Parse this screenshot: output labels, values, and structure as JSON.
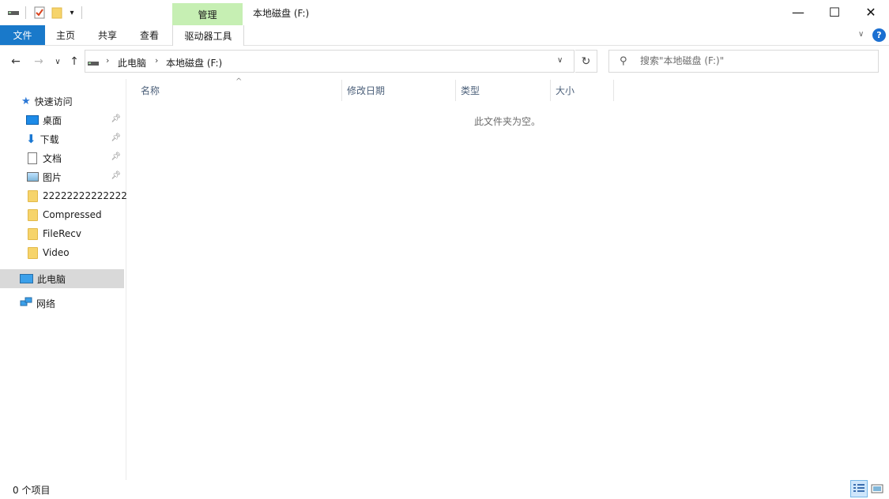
{
  "window": {
    "title": "本地磁盘 (F:)",
    "context_tab_group": "管理",
    "controls": {
      "minimize": "—",
      "maximize": "☐",
      "close": "✕"
    }
  },
  "ribbon": {
    "tabs": [
      "文件",
      "主页",
      "共享",
      "查看",
      "驱动器工具"
    ],
    "help": "?",
    "collapse": "∨"
  },
  "address": {
    "crumbs": [
      "此电脑",
      "本地磁盘 (F:)"
    ],
    "separator": "›",
    "dropdown": "∨",
    "refresh": "↻"
  },
  "search": {
    "placeholder": "搜索\"本地磁盘 (F:)\""
  },
  "nav": {
    "quick_access": "快速访问",
    "pinned": [
      "桌面",
      "下载",
      "文档",
      "图片"
    ],
    "folders": [
      "22222222222222",
      "Compressed",
      "FileRecv",
      "Video"
    ],
    "this_pc": "此电脑",
    "network": "网络"
  },
  "columns": [
    "名称",
    "修改日期",
    "类型",
    "大小"
  ],
  "empty_message": "此文件夹为空。",
  "status": {
    "item_count": "0 个项目"
  },
  "colors": {
    "accent": "#1979ca",
    "manage_tab": "#c6efb3",
    "selected": "#d9d9d9"
  }
}
